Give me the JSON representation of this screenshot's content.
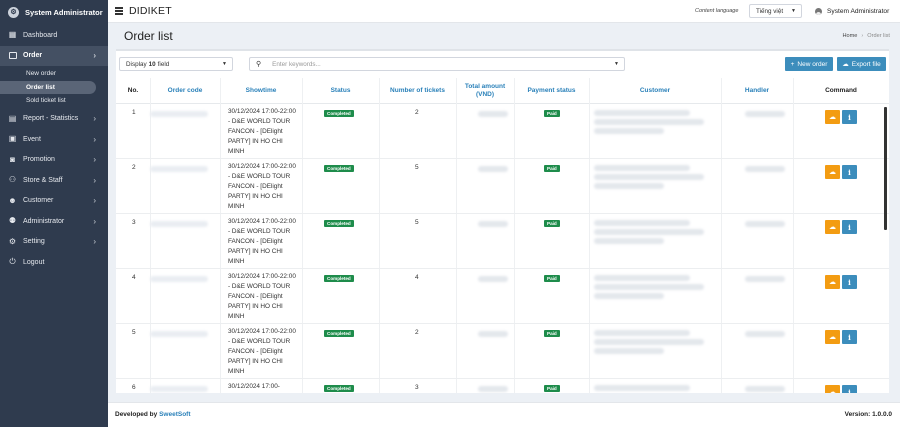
{
  "sidebar": {
    "user_name": "System Administrator",
    "items": [
      {
        "label": "Dashboard",
        "icon": "dashboard-icon"
      },
      {
        "label": "Order",
        "icon": "order-icon"
      },
      {
        "label": "Report - Statistics",
        "icon": "report-icon"
      },
      {
        "label": "Event",
        "icon": "event-icon"
      },
      {
        "label": "Promotion",
        "icon": "promotion-icon"
      },
      {
        "label": "Store & Staff",
        "icon": "store-icon"
      },
      {
        "label": "Customer",
        "icon": "customer-icon"
      },
      {
        "label": "Administrator",
        "icon": "administrator-icon"
      },
      {
        "label": "Setting",
        "icon": "setting-icon"
      },
      {
        "label": "Logout",
        "icon": "logout-icon"
      }
    ],
    "order_sub": [
      "New order",
      "Order list",
      "Sold ticket list"
    ]
  },
  "topbar": {
    "app_title": "DIDIKET",
    "lang_label": "Content language",
    "lang_value": "Tiếng việt",
    "user_name": "System Administrator"
  },
  "page": {
    "title": "Order list",
    "breadcrumb_home": "Home",
    "breadcrumb_current": "Order list"
  },
  "toolbar": {
    "display_prefix": "Display",
    "display_count": "10",
    "display_suffix": "field",
    "search_placeholder": "Enter keywords...",
    "new_order": "New order",
    "export_file": "Export file"
  },
  "table": {
    "headers": {
      "no": "No.",
      "order_code": "Order code",
      "showtime": "Showtime",
      "status": "Status",
      "tickets": "Number of tickets",
      "total": "Total amount (VND)",
      "payment": "Payment status",
      "customer": "Customer",
      "handler": "Handler",
      "command": "Command"
    },
    "rows": [
      {
        "no": "1",
        "showtime": "30/12/2024 17:00-22:00 - D&E WORLD TOUR FANCON - [DElight PARTY] IN HO CHI MINH",
        "status": "Completed",
        "tickets": "2",
        "payment": "Paid"
      },
      {
        "no": "2",
        "showtime": "30/12/2024 17:00-22:00 - D&E WORLD TOUR FANCON - [DElight PARTY] IN HO CHI MINH",
        "status": "Completed",
        "tickets": "5",
        "payment": "Paid"
      },
      {
        "no": "3",
        "showtime": "30/12/2024 17:00-22:00 - D&E WORLD TOUR FANCON - [DElight PARTY] IN HO CHI MINH",
        "status": "Completed",
        "tickets": "5",
        "payment": "Paid"
      },
      {
        "no": "4",
        "showtime": "30/12/2024 17:00-22:00 - D&E WORLD TOUR FANCON - [DElight PARTY] IN HO CHI MINH",
        "status": "Completed",
        "tickets": "4",
        "payment": "Paid"
      },
      {
        "no": "5",
        "showtime": "30/12/2024 17:00-22:00 - D&E WORLD TOUR FANCON - [DElight PARTY] IN HO CHI MINH",
        "status": "Completed",
        "tickets": "2",
        "payment": "Paid"
      },
      {
        "no": "6",
        "showtime": "30/12/2024 17:00-",
        "status": "Completed",
        "tickets": "3",
        "payment": "Paid"
      }
    ]
  },
  "footer": {
    "developed_by": "Developed by",
    "company": "SweetSoft",
    "version": "Version: 1.0.0.0"
  },
  "colors": {
    "sidebar_bg": "#2f3b4e",
    "accent": "#3c8dbc",
    "status_green": "#1e8c4b",
    "download_orange": "#f39c12"
  }
}
